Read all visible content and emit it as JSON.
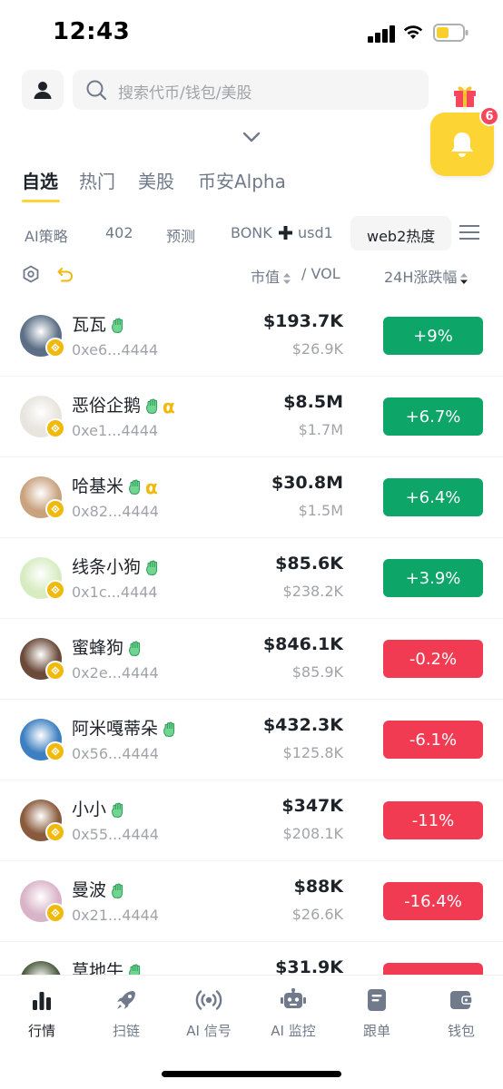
{
  "status_bar": {
    "time": "12:43"
  },
  "search": {
    "placeholder": "搜索代币/钱包/美股"
  },
  "notification": {
    "badge_count": "6"
  },
  "main_tabs": [
    {
      "label": "自选",
      "active": true
    },
    {
      "label": "热门",
      "active": false
    },
    {
      "label": "美股",
      "active": false
    },
    {
      "label": "币安Alpha",
      "active": false
    }
  ],
  "sub_tabs": [
    {
      "label": "AI策略"
    },
    {
      "label": "402"
    },
    {
      "label": "预测"
    },
    {
      "label": "BONK"
    },
    {
      "label": "usd1"
    },
    {
      "label": "web2热度",
      "active": true
    }
  ],
  "list_header": {
    "mcap_label": "市值",
    "vol_label": "/ VOL",
    "change_label": "24H涨跌幅"
  },
  "tokens": [
    {
      "name": "瓦瓦",
      "address": "0xe6...4444",
      "mcap": "$193.7K",
      "vol": "$26.9K",
      "change": "+9%",
      "direction": "up",
      "alpha": false,
      "avatar_color": "#5c6f86"
    },
    {
      "name": "恶俗企鹅",
      "address": "0xe1...4444",
      "mcap": "$8.5M",
      "vol": "$1.7M",
      "change": "+6.7%",
      "direction": "up",
      "alpha": true,
      "alpha_label": "α",
      "avatar_color": "#e8e4de"
    },
    {
      "name": "哈基米",
      "address": "0x82...4444",
      "mcap": "$30.8M",
      "vol": "$1.5M",
      "change": "+6.4%",
      "direction": "up",
      "alpha": true,
      "alpha_label": "α",
      "avatar_color": "#c9a27e"
    },
    {
      "name": "线条小狗",
      "address": "0x1c...4444",
      "mcap": "$85.6K",
      "vol": "$238.2K",
      "change": "+3.9%",
      "direction": "up",
      "alpha": false,
      "avatar_color": "#d8ecc2"
    },
    {
      "name": "蜜蜂狗",
      "address": "0x2e...4444",
      "mcap": "$846.1K",
      "vol": "$85.9K",
      "change": "-0.2%",
      "direction": "down",
      "alpha": false,
      "avatar_color": "#6b4a3a"
    },
    {
      "name": "阿米嘎蒂朵",
      "address": "0x56...4444",
      "mcap": "$432.3K",
      "vol": "$125.8K",
      "change": "-6.1%",
      "direction": "down",
      "alpha": false,
      "avatar_color": "#3d7fc0"
    },
    {
      "name": "小小",
      "address": "0x55...4444",
      "mcap": "$347K",
      "vol": "$208.1K",
      "change": "-11%",
      "direction": "down",
      "alpha": false,
      "avatar_color": "#8a5a3c"
    },
    {
      "name": "曼波",
      "address": "0x21...4444",
      "mcap": "$88K",
      "vol": "$26.6K",
      "change": "-16.4%",
      "direction": "down",
      "alpha": false,
      "avatar_color": "#d9b3c8"
    },
    {
      "name": "草地牛",
      "address": "",
      "mcap": "$31.9K",
      "vol": "",
      "change": "",
      "direction": "down",
      "alpha": false,
      "avatar_color": "#4b5a3c"
    }
  ],
  "bottom_nav": [
    {
      "label": "行情",
      "icon": "bar-chart-icon",
      "active": true
    },
    {
      "label": "扫链",
      "icon": "rocket-icon",
      "active": false
    },
    {
      "label": "AI 信号",
      "icon": "broadcast-icon",
      "active": false
    },
    {
      "label": "AI 监控",
      "icon": "robot-icon",
      "active": false
    },
    {
      "label": "跟单",
      "icon": "document-icon",
      "active": false
    },
    {
      "label": "钱包",
      "icon": "wallet-icon",
      "active": false
    }
  ],
  "colors": {
    "accent": "#fcd535",
    "up": "#0ea569",
    "down": "#f03b52",
    "muted": "#707a8a"
  }
}
